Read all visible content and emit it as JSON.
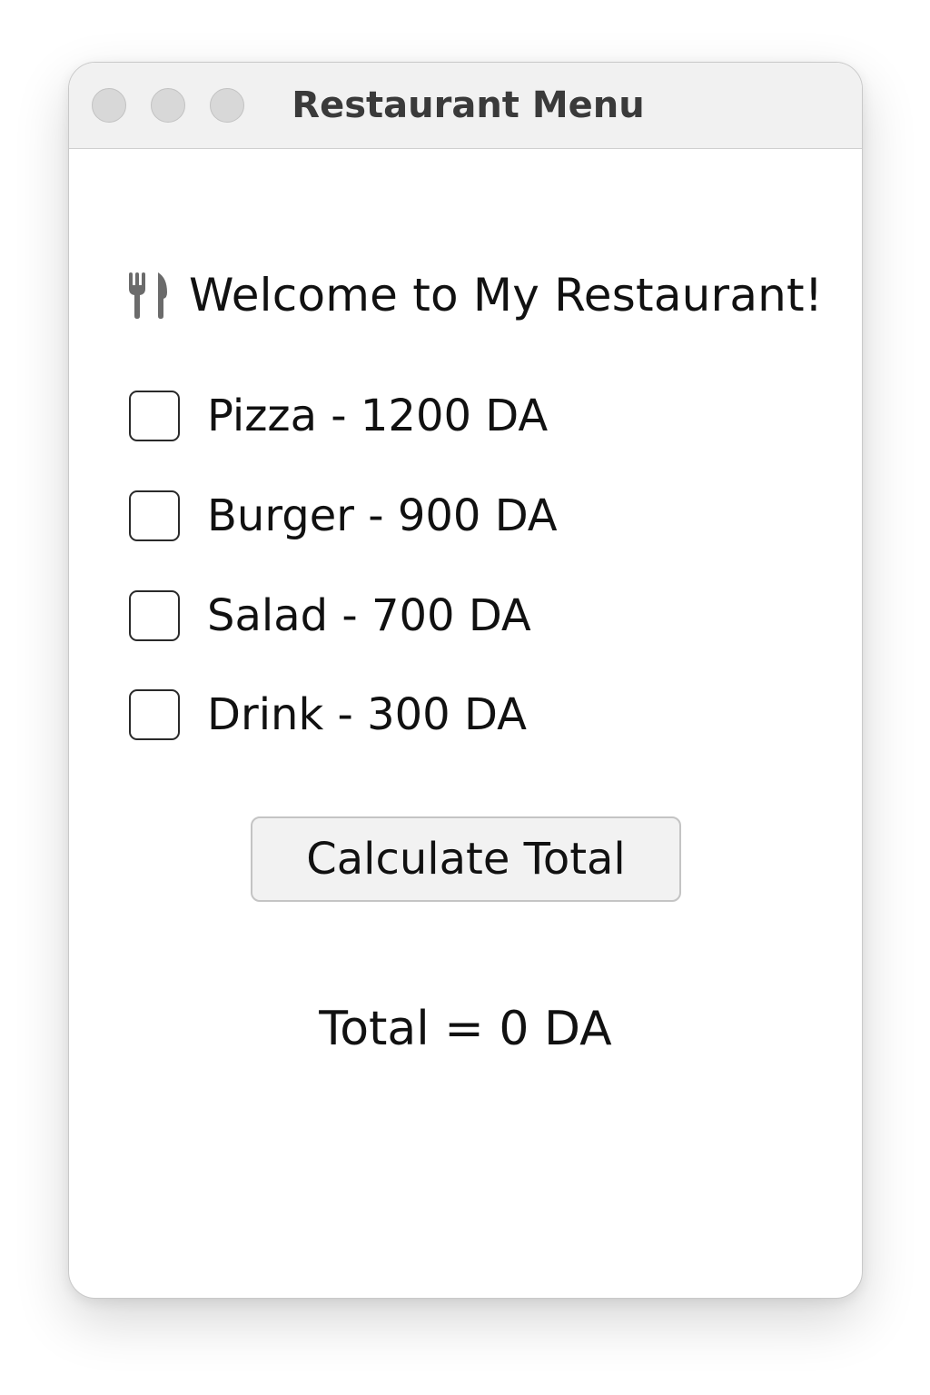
{
  "window": {
    "title": "Restaurant Menu"
  },
  "header": {
    "icon": "fork-knife-icon",
    "welcome": "Welcome to My Restaurant!"
  },
  "menu": {
    "items": [
      {
        "label": "Pizza - 1200 DA",
        "checked": false
      },
      {
        "label": "Burger - 900 DA",
        "checked": false
      },
      {
        "label": "Salad - 700 DA",
        "checked": false
      },
      {
        "label": "Drink - 300 DA",
        "checked": false
      }
    ]
  },
  "actions": {
    "calculate_label": "Calculate Total"
  },
  "result": {
    "total_text": "Total = 0 DA"
  },
  "colors": {
    "titlebar": "#f1f1f1",
    "traffic_light": "#d8d8d8",
    "button_bg": "#f2f2f2",
    "text": "#111111"
  }
}
